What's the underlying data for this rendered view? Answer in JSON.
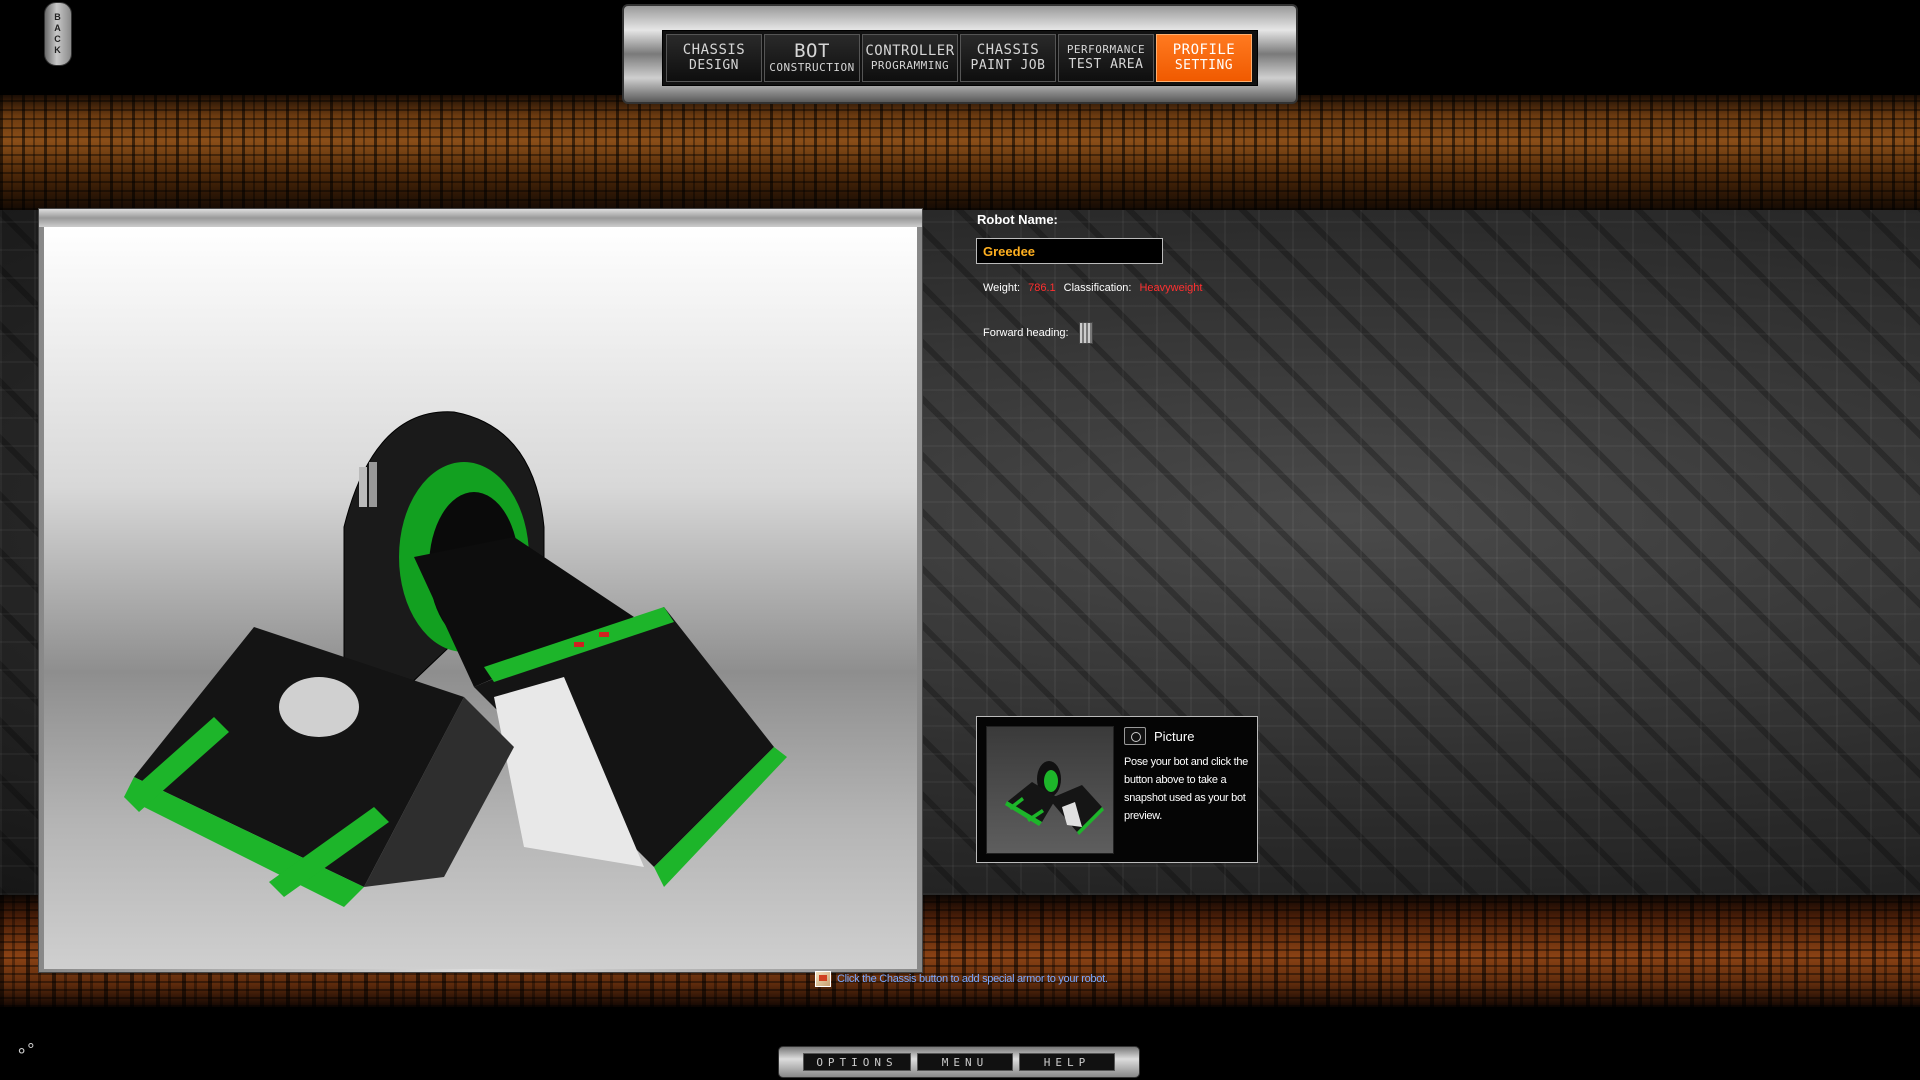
{
  "back_button": {
    "letters": [
      "B",
      "A",
      "C",
      "K"
    ]
  },
  "tabs": [
    {
      "line1": "CHASSIS",
      "line2": "DESIGN",
      "active": false
    },
    {
      "line1": "BOT",
      "line2": "CONSTRUCTION",
      "active": false
    },
    {
      "line1": "CONTROLLER",
      "line2": "PROGRAMMING",
      "active": false
    },
    {
      "line1": "CHASSIS",
      "line2": "PAINT JOB",
      "active": false
    },
    {
      "line1": "PERFORMANCE",
      "line2": "TEST AREA",
      "active": false
    },
    {
      "line1": "PROFILE",
      "line2": "SETTING",
      "active": true
    }
  ],
  "profile": {
    "robot_name_label": "Robot Name:",
    "robot_name_value": "Greedee",
    "weight_label": "Weight:",
    "weight_value": "786.1",
    "classification_label": "Classification:",
    "classification_value": "Heavyweight",
    "forward_heading_label": "Forward heading:"
  },
  "picture": {
    "button_label": "Picture",
    "description": "Pose your bot and click the button above to take a snapshot used as your bot preview."
  },
  "hint": {
    "text": "Click the Chassis button to add special armor to your robot."
  },
  "bottom_buttons": {
    "options": "OPTIONS",
    "menu": "MENU",
    "help": "HELP"
  },
  "colors": {
    "accent_active_tab": "#f05a00",
    "robot_green": "#1db52a",
    "value_red": "#ff3030",
    "name_orange": "#ffb020",
    "hint_blue": "#7aa8ff"
  }
}
